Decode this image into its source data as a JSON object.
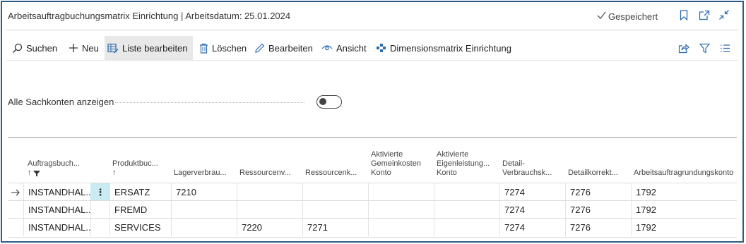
{
  "window": {
    "title": "Arbeitsauftragbuchungsmatrix Einrichtung | Arbeitsdatum: 25.01.2024",
    "saved_label": "Gespeichert",
    "icons": [
      "bookmark-icon",
      "open-new-window-icon",
      "collapse-icon"
    ]
  },
  "actions": {
    "search": "Suchen",
    "new": "Neu",
    "edit_list": "Liste bearbeiten",
    "delete": "Löschen",
    "edit": "Bearbeiten",
    "view": "Ansicht",
    "dimension_matrix": "Dimensionsmatrix Einrichtung",
    "right_icons": [
      "share-icon",
      "filter-icon",
      "list-view-icon"
    ]
  },
  "toggle": {
    "label": "Alle Sachkonten anzeigen",
    "on": false
  },
  "table": {
    "columns": [
      {
        "lines": [
          "Auftragsbuch..."
        ],
        "sort_indicator": "↑",
        "filter": true
      },
      {
        "lines": [
          "Produktbuc..."
        ],
        "sort_indicator": "↑",
        "filter": false
      },
      {
        "lines": [
          "Lagerverbrau..."
        ]
      },
      {
        "lines": [
          "Ressourcenv..."
        ]
      },
      {
        "lines": [
          "Ressourcenk..."
        ]
      },
      {
        "lines": [
          "Aktivierte",
          "Gemeinkosten",
          "Konto"
        ]
      },
      {
        "lines": [
          "Aktivierte",
          "Eigenleistung...",
          "Konto"
        ]
      },
      {
        "lines": [
          "Detail-",
          "Verbrauchsk..."
        ]
      },
      {
        "lines": [
          "Detailkorrekt..."
        ]
      },
      {
        "lines": [
          "Arbeitsauftragrundungskonto"
        ]
      }
    ],
    "rows": [
      {
        "selected": true,
        "cells": [
          "INSTANDHAL...",
          "ERSATZ",
          "7210",
          "",
          "",
          "",
          "",
          "7274",
          "7276",
          "1792"
        ]
      },
      {
        "selected": false,
        "cells": [
          "INSTANDHAL...",
          "FREMD",
          "",
          "",
          "",
          "",
          "",
          "7274",
          "7276",
          "1792"
        ]
      },
      {
        "selected": false,
        "cells": [
          "INSTANDHAL...",
          "SERVICES",
          "",
          "7220",
          "7271",
          "",
          "",
          "7274",
          "7276",
          "1792"
        ]
      }
    ]
  },
  "colors": {
    "frame_border": "#2e5c8a",
    "accent_teal": "#c8ecf2",
    "active_action_bg": "#e8e8e8"
  }
}
